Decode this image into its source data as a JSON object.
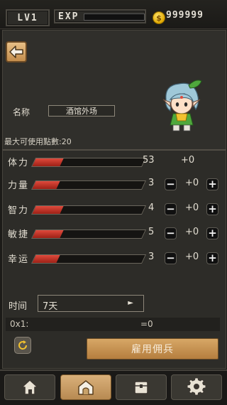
{
  "top_bar": {
    "level_label": "LV1",
    "exp_label": "EXP",
    "exp_progress": 0.0,
    "coin_symbol": "$",
    "coin_value": "999999"
  },
  "hero": {
    "name_label": "名称",
    "name_value": "酒馆外场",
    "points_text": "最大可使用點數:20"
  },
  "stats": [
    {
      "label": "体力",
      "fill": 0.25,
      "value": "53",
      "bonus": "+0",
      "has_buttons": false
    },
    {
      "label": "力量",
      "fill": 0.22,
      "value": "3",
      "bonus": "+0",
      "has_buttons": true
    },
    {
      "label": "智力",
      "fill": 0.25,
      "value": "4",
      "bonus": "+0",
      "has_buttons": true
    },
    {
      "label": "敏捷",
      "fill": 0.25,
      "value": "5",
      "bonus": "+0",
      "has_buttons": true
    },
    {
      "label": "幸运",
      "fill": 0.22,
      "value": "3",
      "bonus": "+0",
      "has_buttons": true
    }
  ],
  "stat_buttons": {
    "minus": "−",
    "plus": "+"
  },
  "hire": {
    "time_label": "时间",
    "time_value": "7天",
    "time_arrow": "►",
    "cost_left": "0x1:",
    "cost_right": "=0",
    "hire_button": "雇用佣兵"
  },
  "icons": {
    "back": "back-arrow-icon",
    "refresh": "refresh-icon",
    "nav": [
      "home-icon",
      "house-icon",
      "inventory-icon",
      "gear-icon"
    ]
  },
  "colors": {
    "accent_gold": "#d7a766",
    "stat_fill": "#c8362a",
    "coin": "#f2c12e"
  }
}
